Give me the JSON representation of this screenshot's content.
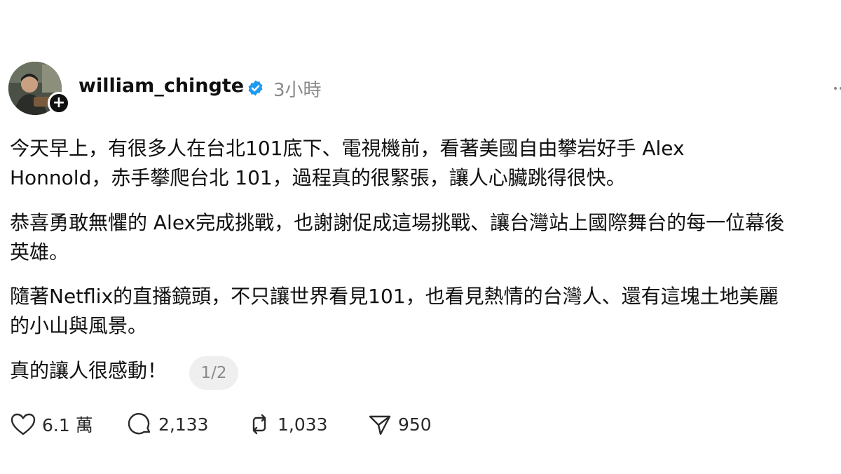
{
  "post": {
    "username": "william_chingte",
    "timestamp": "3小時",
    "paragraphs": [
      {
        "line1": "今天早上，有很多人在台北101底下、電視機前，看著美國自由攀岩好手 Alex",
        "line2": "Honnold，赤手攀爬台北 101，過程真的很緊張，讓人心臟跳得很快。"
      },
      {
        "line1": "恭喜勇敢無懼的 Alex完成挑戰，也謝謝促成這場挑戰、讓台灣站上國際舞台的每一位幕後",
        "line2": "英雄。"
      },
      {
        "line1": "隨著Netflix的直播鏡頭，不只讓世界看見101，也看見熱情的台灣人、還有這塊土地美麗",
        "line2": "的小山與風景。"
      }
    ],
    "closing": "真的讓人很感動！",
    "page_indicator": "1/2"
  },
  "actions": {
    "likes": "6.1 萬",
    "comments": "2,133",
    "reposts": "1,033",
    "shares": "950"
  },
  "icons": {
    "follow": "plus-icon",
    "verified": "verified-badge-icon",
    "more": "more-options-icon",
    "like": "heart-icon",
    "comment": "comment-bubble-icon",
    "repost": "repost-icon",
    "share": "send-icon"
  },
  "colors": {
    "verified_blue": "#1d9bf0",
    "muted_text": "#8a8a8a"
  }
}
